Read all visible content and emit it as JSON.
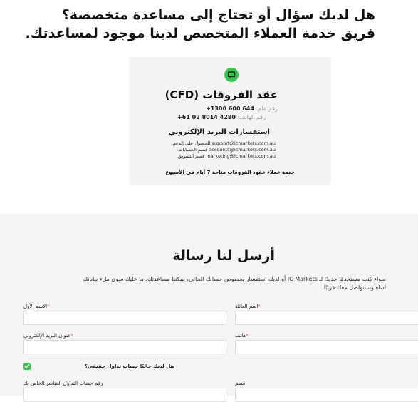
{
  "header": {
    "line1": "هل لديك سؤال أو تحتاج إلى مساعدة متخصصة؟",
    "line2": "فريق خدمة العملاء المتخصص لدينا موجود لمساعدتك."
  },
  "contact_card": {
    "title": "عقد الفروقات (CFD)",
    "phone_line": "+1300 600 644",
    "phone_label": "رقم عام:",
    "phone2_line": "+61 02 8014 4280",
    "phone2_label": "رقم الهاتف:",
    "email_heading": "استفسارات البريد الإلكتروني",
    "emails": [
      "support@icmarkets.com.au للحصول على الدعم:",
      "accounts@icmarkets.com.au قسم الحسابات:",
      "marketing@icmarkets.com.au قسم التسويق:"
    ],
    "note": "خدمة عملاء عقود الفروقات متاحة 7 أيام في الأسبوع"
  },
  "form": {
    "title": "أرسل لنا رسالة",
    "intro": "سواء كنت مستخدمًا جديدًا لـ IC Markets أو لديك استفسار بخصوص حسابك الحالي، يمكننا مساعدتك. ما عليك سوى ملء بياناتك أدناه وسنتواصل معك قريبًا.",
    "fields": {
      "first_name": "الاسم الأول",
      "last_name": "اسم العائلة",
      "email": "عنوان البريد الإلكتروني",
      "phone": "هاتف",
      "account_number": "رقم حساب التداول المباشر الخاص بك",
      "department": "قسم"
    },
    "required_mark": "*",
    "real_account_question": "هل لديك حاليًا حساب تداول حقيقي؟",
    "real_account_checked": true
  },
  "colors": {
    "accent": "#35c64f",
    "card_bg": "#f3f3f3",
    "form_bg": "#f4f4f4"
  }
}
